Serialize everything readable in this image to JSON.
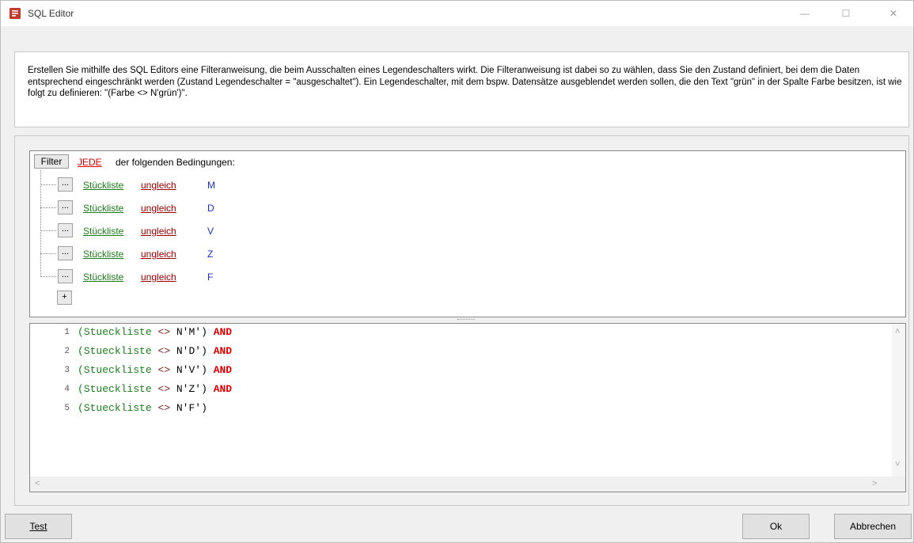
{
  "window": {
    "title": "SQL Editor",
    "min_glyph": "—",
    "max_glyph": "☐",
    "close_glyph": "✕"
  },
  "description": "Erstellen Sie mithilfe des SQL Editors eine Filteranweisung, die beim Ausschalten eines Legendeschalters wirkt. Die Filteranweisung ist dabei so zu wählen, dass Sie den Zustand definiert, bei dem die Daten entsprechend eingeschränkt werden (Zustand Legendeschalter = \"ausgeschaltet\"). Ein Legendeschalter, mit dem bspw. Datensätze ausgeblendet werden sollen, die den Text \"grün\" in der Spalte Farbe besitzen, ist wie folgt zu definieren: \"(Farbe <> N'grün')\".",
  "filter": {
    "button_label": "Filter",
    "quantifier": "JEDE",
    "suffix": "der folgenden Bedingungen:",
    "conditions": [
      {
        "dots": "...",
        "field": "Stückliste",
        "operator": "ungleich",
        "value": "M"
      },
      {
        "dots": "...",
        "field": "Stückliste",
        "operator": "ungleich",
        "value": "D"
      },
      {
        "dots": "...",
        "field": "Stückliste",
        "operator": "ungleich",
        "value": "V"
      },
      {
        "dots": "...",
        "field": "Stückliste",
        "operator": "ungleich",
        "value": "Z"
      },
      {
        "dots": "...",
        "field": "Stückliste",
        "operator": "ungleich",
        "value": "F"
      }
    ],
    "add_label": "+"
  },
  "sql": {
    "lines": [
      {
        "num": "1",
        "open": "(",
        "field": "Stueckliste",
        "op": "<>",
        "val": "N'M')",
        "kw": "AND"
      },
      {
        "num": "2",
        "open": "(",
        "field": "Stueckliste",
        "op": "<>",
        "val": "N'D')",
        "kw": "AND"
      },
      {
        "num": "3",
        "open": "(",
        "field": "Stueckliste",
        "op": "<>",
        "val": "N'V')",
        "kw": "AND"
      },
      {
        "num": "4",
        "open": "(",
        "field": "Stueckliste",
        "op": "<>",
        "val": "N'Z')",
        "kw": "AND"
      },
      {
        "num": "5",
        "open": "(",
        "field": "Stueckliste",
        "op": "<>",
        "val": "N'F')",
        "kw": ""
      }
    ]
  },
  "buttons": {
    "test": "Test",
    "ok": "Ok",
    "cancel": "Abbrechen"
  },
  "scroll_arrows": {
    "up": "˄",
    "down": "˅",
    "left": "<",
    "right": ">"
  }
}
